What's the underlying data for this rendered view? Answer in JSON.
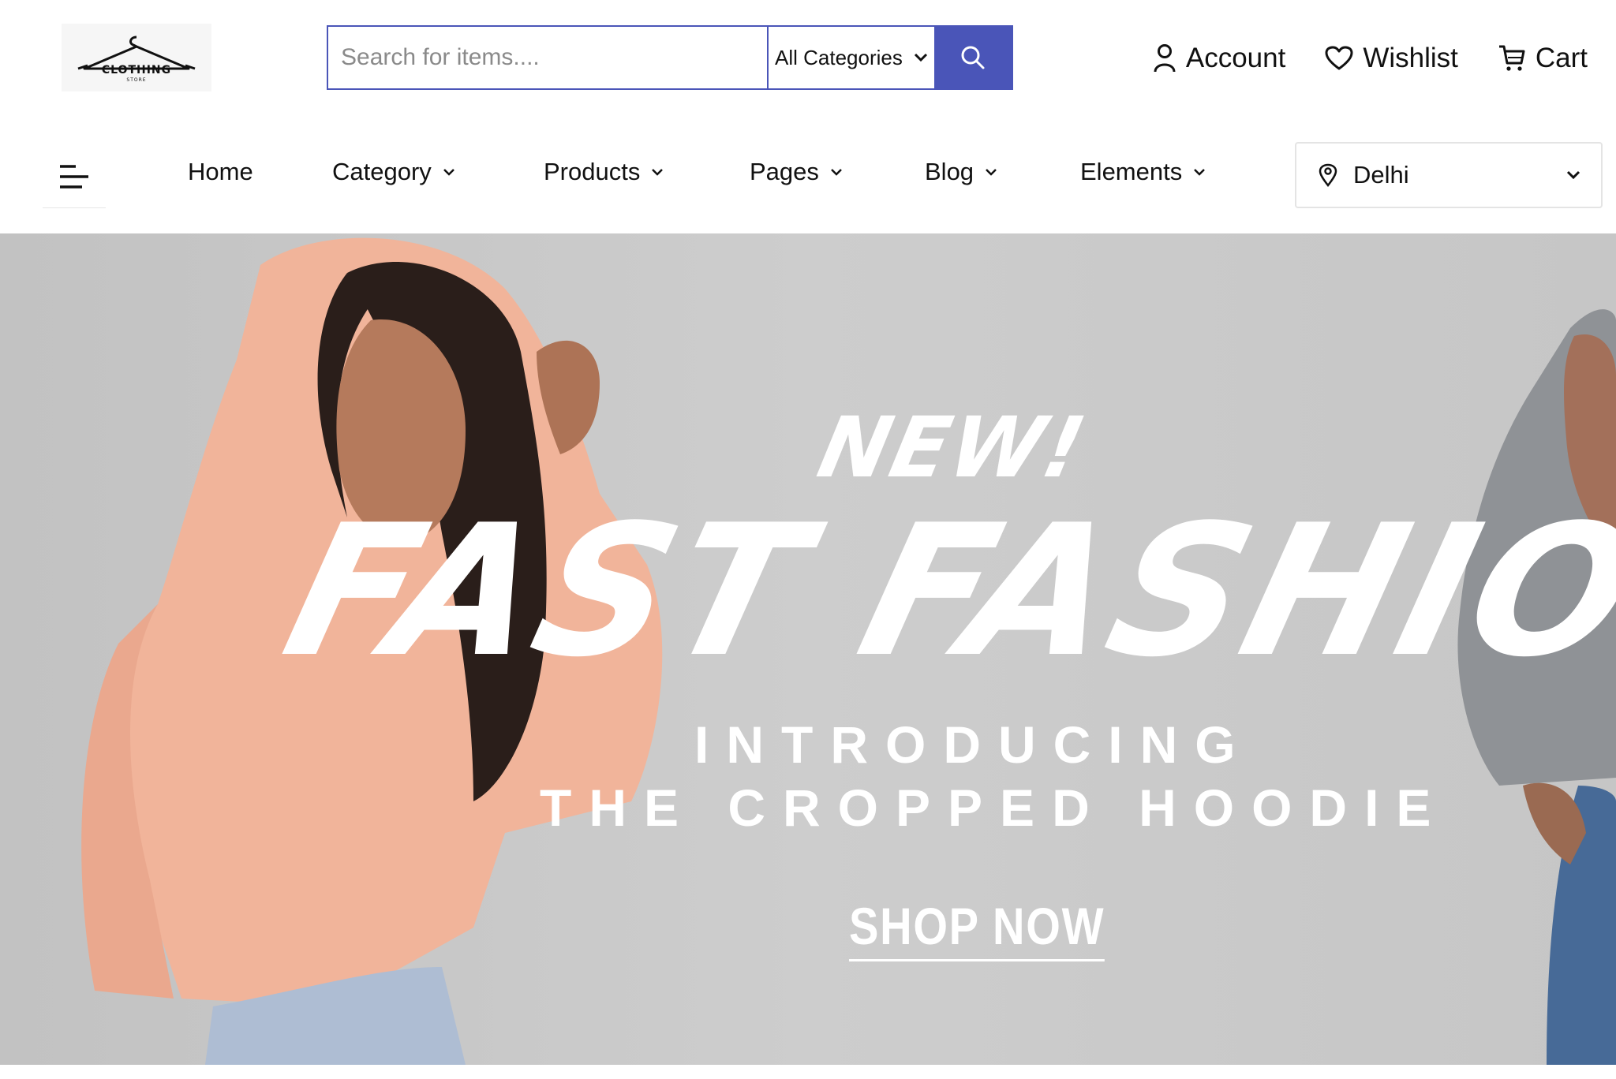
{
  "logo": {
    "word": "CLOTHING",
    "sub": "STORE"
  },
  "search": {
    "placeholder": "Search for items....",
    "value": "",
    "category_selected": "All Categories"
  },
  "header_links": [
    {
      "label": "Account",
      "icon": "user-icon"
    },
    {
      "label": "Wishlist",
      "icon": "heart-icon"
    },
    {
      "label": "Cart",
      "icon": "cart-icon"
    }
  ],
  "nav": {
    "items": [
      {
        "label": "Home",
        "has_dropdown": false
      },
      {
        "label": "Category",
        "has_dropdown": true
      },
      {
        "label": "Products",
        "has_dropdown": true
      },
      {
        "label": "Pages",
        "has_dropdown": true
      },
      {
        "label": "Blog",
        "has_dropdown": true
      },
      {
        "label": "Elements",
        "has_dropdown": true
      }
    ],
    "location": "Delhi"
  },
  "hero": {
    "tag": "NEW!",
    "headline": "FAST FASHION",
    "line1": "INTRODUCING",
    "line2": "THE CROPPED HOODIE",
    "cta": "SHOP NOW"
  },
  "colors": {
    "accent": "#4a55b8",
    "hero_bg": "#c9c9c9",
    "hoodie_peach": "#f1b49a",
    "hoodie_grey": "#8f9296",
    "text": "#111111"
  }
}
